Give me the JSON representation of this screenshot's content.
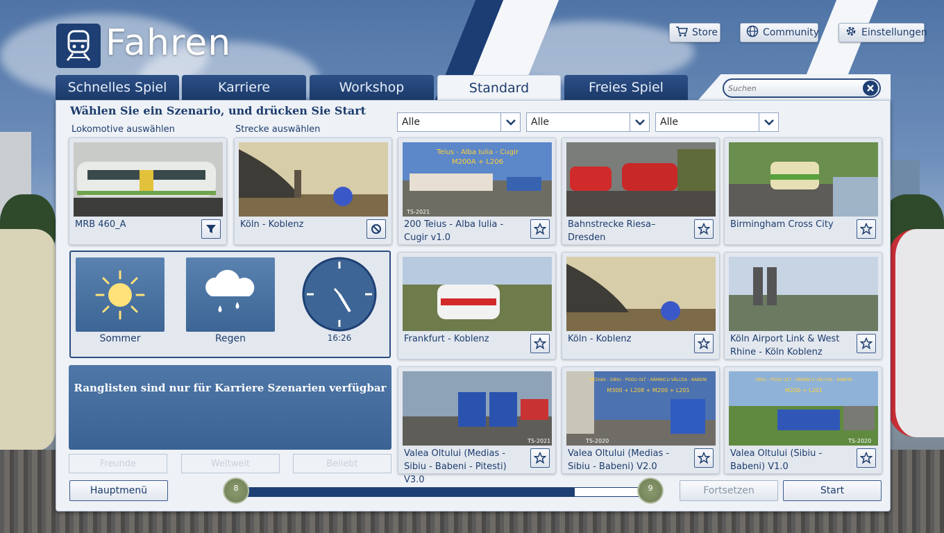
{
  "header": {
    "title": "Fahren",
    "store": "Store",
    "community": "Community",
    "settings": "Einstellungen"
  },
  "tabs": [
    {
      "label": "Schnelles Spiel"
    },
    {
      "label": "Karriere"
    },
    {
      "label": "Workshop"
    },
    {
      "label": "Standard"
    },
    {
      "label": "Freies Spiel"
    }
  ],
  "search": {
    "placeholder": "Suchen"
  },
  "main": {
    "instruction": "Wählen Sie ein Szenario, und drücken Sie Start",
    "loco_label": "Lokomotive auswählen",
    "route_label": "Strecke auswählen"
  },
  "filters": [
    "Alle",
    "Alle",
    "Alle"
  ],
  "loco": {
    "name": "MRB 460_A"
  },
  "route": {
    "name": "Köln - Koblenz"
  },
  "scenarios": [
    {
      "name": "200 Teius - Alba Iulia - Cugir v1.0"
    },
    {
      "name": "Bahnstrecke Riesa–Dresden"
    },
    {
      "name": "Birmingham Cross City"
    },
    {
      "name": "Frankfurt - Koblenz"
    },
    {
      "name": "Köln - Koblenz"
    },
    {
      "name": "Köln Airport Link & West Rhine - Köln Koblenz"
    },
    {
      "name": "Valea Oltului (Medias - Sibiu - Babeni - Pitesti) V3.0"
    },
    {
      "name": "Valea Oltului (Medias - Sibiu - Babeni) V2.0"
    },
    {
      "name": "Valea Oltului (Sibiu - Babeni) V1.0"
    }
  ],
  "thumb_texts": {
    "t1_top": "Teius - Alba Iulia - Cugir",
    "t1_sub": "M200A + L206",
    "t1_badge": "TS-2021",
    "t7_badge": "TS-2021",
    "t8_top": "MEDIAS - SIBIU - PODU OLT - RÂMNICU VÂLCEA - BABENI",
    "t8_sub": "M300 + L208 + M200 + L201",
    "t8_badge": "TS-2020",
    "t9_top": "SIBIU - PODU OLT - RÂMNICU VÂLCEA - BABENI",
    "t9_sub": "M200 + L201",
    "t9_badge": "TS-2020"
  },
  "weather": {
    "season": "Sommer",
    "condition": "Regen",
    "time": "16:26"
  },
  "leaderboard": {
    "message": "Ranglisten sind nur für Karriere Szenarien verfügbar",
    "friends": "Freunde",
    "worldwide": "Weltweit",
    "popular": "Beliebt"
  },
  "footer": {
    "main_menu": "Hauptmenü",
    "continue": "Fortsetzen",
    "start": "Start",
    "level_left": "8",
    "level_right": "9",
    "progress": 0.82
  },
  "colors": {
    "accent": "#1e3f73",
    "panel": "#eef2f7",
    "text": "#1d3c6d"
  }
}
